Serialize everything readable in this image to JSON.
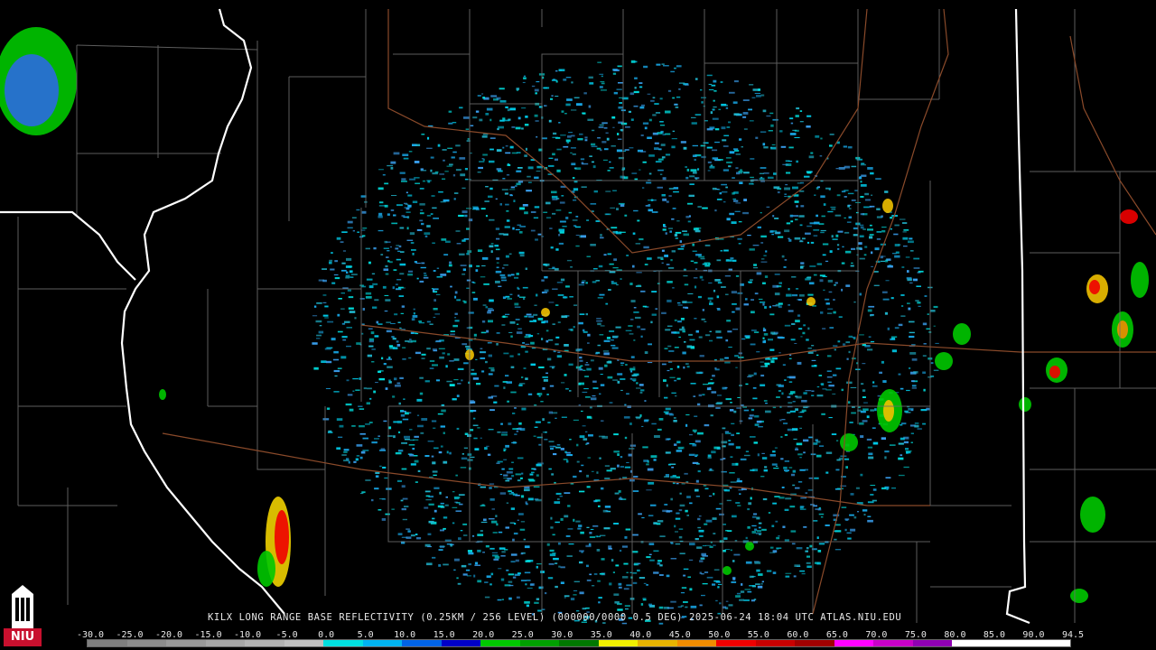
{
  "caption": "KILX LONG RANGE BASE REFLECTIVITY (0.25KM / 256 LEVEL) (000000/0000 0.5 DEG) 2025-06-24 18:04 UTC  ATLAS.NIU.EDU",
  "logo": {
    "text": "NIU",
    "icon": "university-tower-icon"
  },
  "scale": {
    "labels": [
      "-30.0",
      "-25.0",
      "-20.0",
      "-15.0",
      "-10.0",
      "-5.0",
      "0.0",
      "5.0",
      "10.0",
      "15.0",
      "20.0",
      "25.0",
      "30.0",
      "35.0",
      "40.0",
      "45.0",
      "50.0",
      "55.0",
      "60.0",
      "65.0",
      "70.0",
      "75.0",
      "80.0",
      "85.0",
      "90.0",
      "94.5"
    ],
    "colors": [
      "#7f7f7f",
      "#8c8c8c",
      "#999999",
      "#a6a6a6",
      "#b3b3b3",
      "#c0c0c0",
      "#00e0e0",
      "#00b4f0",
      "#0064e6",
      "#0000c8",
      "#00c800",
      "#00a000",
      "#007800",
      "#f0f000",
      "#e6b400",
      "#f08c00",
      "#f00000",
      "#c80000",
      "#a00000",
      "#ff00ff",
      "#c800c8",
      "#9000b4",
      "#ffffff",
      "#ffffff",
      "#ffffff"
    ]
  },
  "colors": {
    "background": "#000000",
    "county_lines": "#6e6e6e",
    "state_lines": "#ffffff",
    "highways": "#8a4a2a"
  }
}
